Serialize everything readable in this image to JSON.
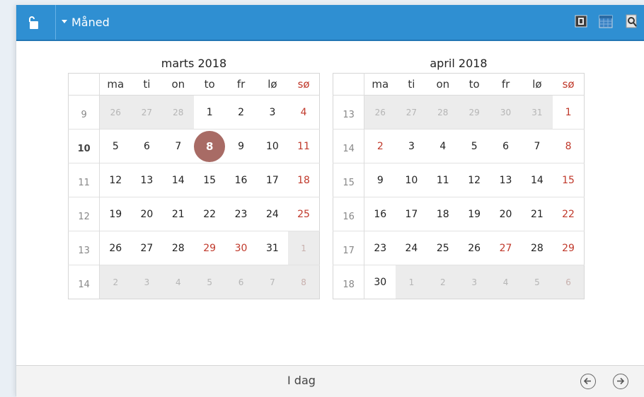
{
  "header": {
    "view_title": "Måned",
    "icons": [
      "unlock-icon",
      "week-view-icon",
      "month-view-icon",
      "search-calendar-icon"
    ]
  },
  "weekdays": [
    "ma",
    "ti",
    "on",
    "to",
    "fr",
    "lø",
    "sø"
  ],
  "calendars": [
    {
      "title": "marts 2018",
      "weeks": [
        {
          "wk": "9",
          "days": [
            "26",
            "27",
            "28",
            "1",
            "2",
            "3",
            "4"
          ],
          "out": [
            0,
            1,
            2
          ]
        },
        {
          "wk": "10",
          "days": [
            "5",
            "6",
            "7",
            "8",
            "9",
            "10",
            "11"
          ],
          "out": []
        },
        {
          "wk": "11",
          "days": [
            "12",
            "13",
            "14",
            "15",
            "16",
            "17",
            "18"
          ],
          "out": []
        },
        {
          "wk": "12",
          "days": [
            "19",
            "20",
            "21",
            "22",
            "23",
            "24",
            "25"
          ],
          "out": []
        },
        {
          "wk": "13",
          "days": [
            "26",
            "27",
            "28",
            "29",
            "30",
            "31",
            "1"
          ],
          "out": [
            6
          ]
        },
        {
          "wk": "14",
          "days": [
            "2",
            "3",
            "4",
            "5",
            "6",
            "7",
            "8"
          ],
          "out": [
            0,
            1,
            2,
            3,
            4,
            5,
            6
          ]
        }
      ]
    },
    {
      "title": "april 2018",
      "weeks": [
        {
          "wk": "13",
          "days": [
            "26",
            "27",
            "28",
            "29",
            "30",
            "31",
            "1"
          ],
          "out": [
            0,
            1,
            2,
            3,
            4,
            5
          ]
        },
        {
          "wk": "14",
          "days": [
            "2",
            "3",
            "4",
            "5",
            "6",
            "7",
            "8"
          ],
          "out": []
        },
        {
          "wk": "15",
          "days": [
            "9",
            "10",
            "11",
            "12",
            "13",
            "14",
            "15"
          ],
          "out": []
        },
        {
          "wk": "16",
          "days": [
            "16",
            "17",
            "18",
            "19",
            "20",
            "21",
            "22"
          ],
          "out": []
        },
        {
          "wk": "17",
          "days": [
            "23",
            "24",
            "25",
            "26",
            "27",
            "28",
            "29"
          ],
          "out": []
        },
        {
          "wk": "18",
          "days": [
            "30",
            "1",
            "2",
            "3",
            "4",
            "5",
            "6"
          ],
          "out": [
            1,
            2,
            3,
            4,
            5,
            6
          ]
        }
      ]
    }
  ],
  "today": {
    "calendar": 0,
    "week": 1,
    "day": 3,
    "week_number": "10"
  },
  "holidays": {
    "marts 2018": [
      "29",
      "30"
    ],
    "april 2018": [
      "2",
      "27"
    ]
  },
  "footer": {
    "today_label": "I dag"
  },
  "colors": {
    "header_bg": "#2f8fd2",
    "today_bg": "#a86b65",
    "holiday": "#c0392b",
    "outside_bg": "#ececec"
  }
}
